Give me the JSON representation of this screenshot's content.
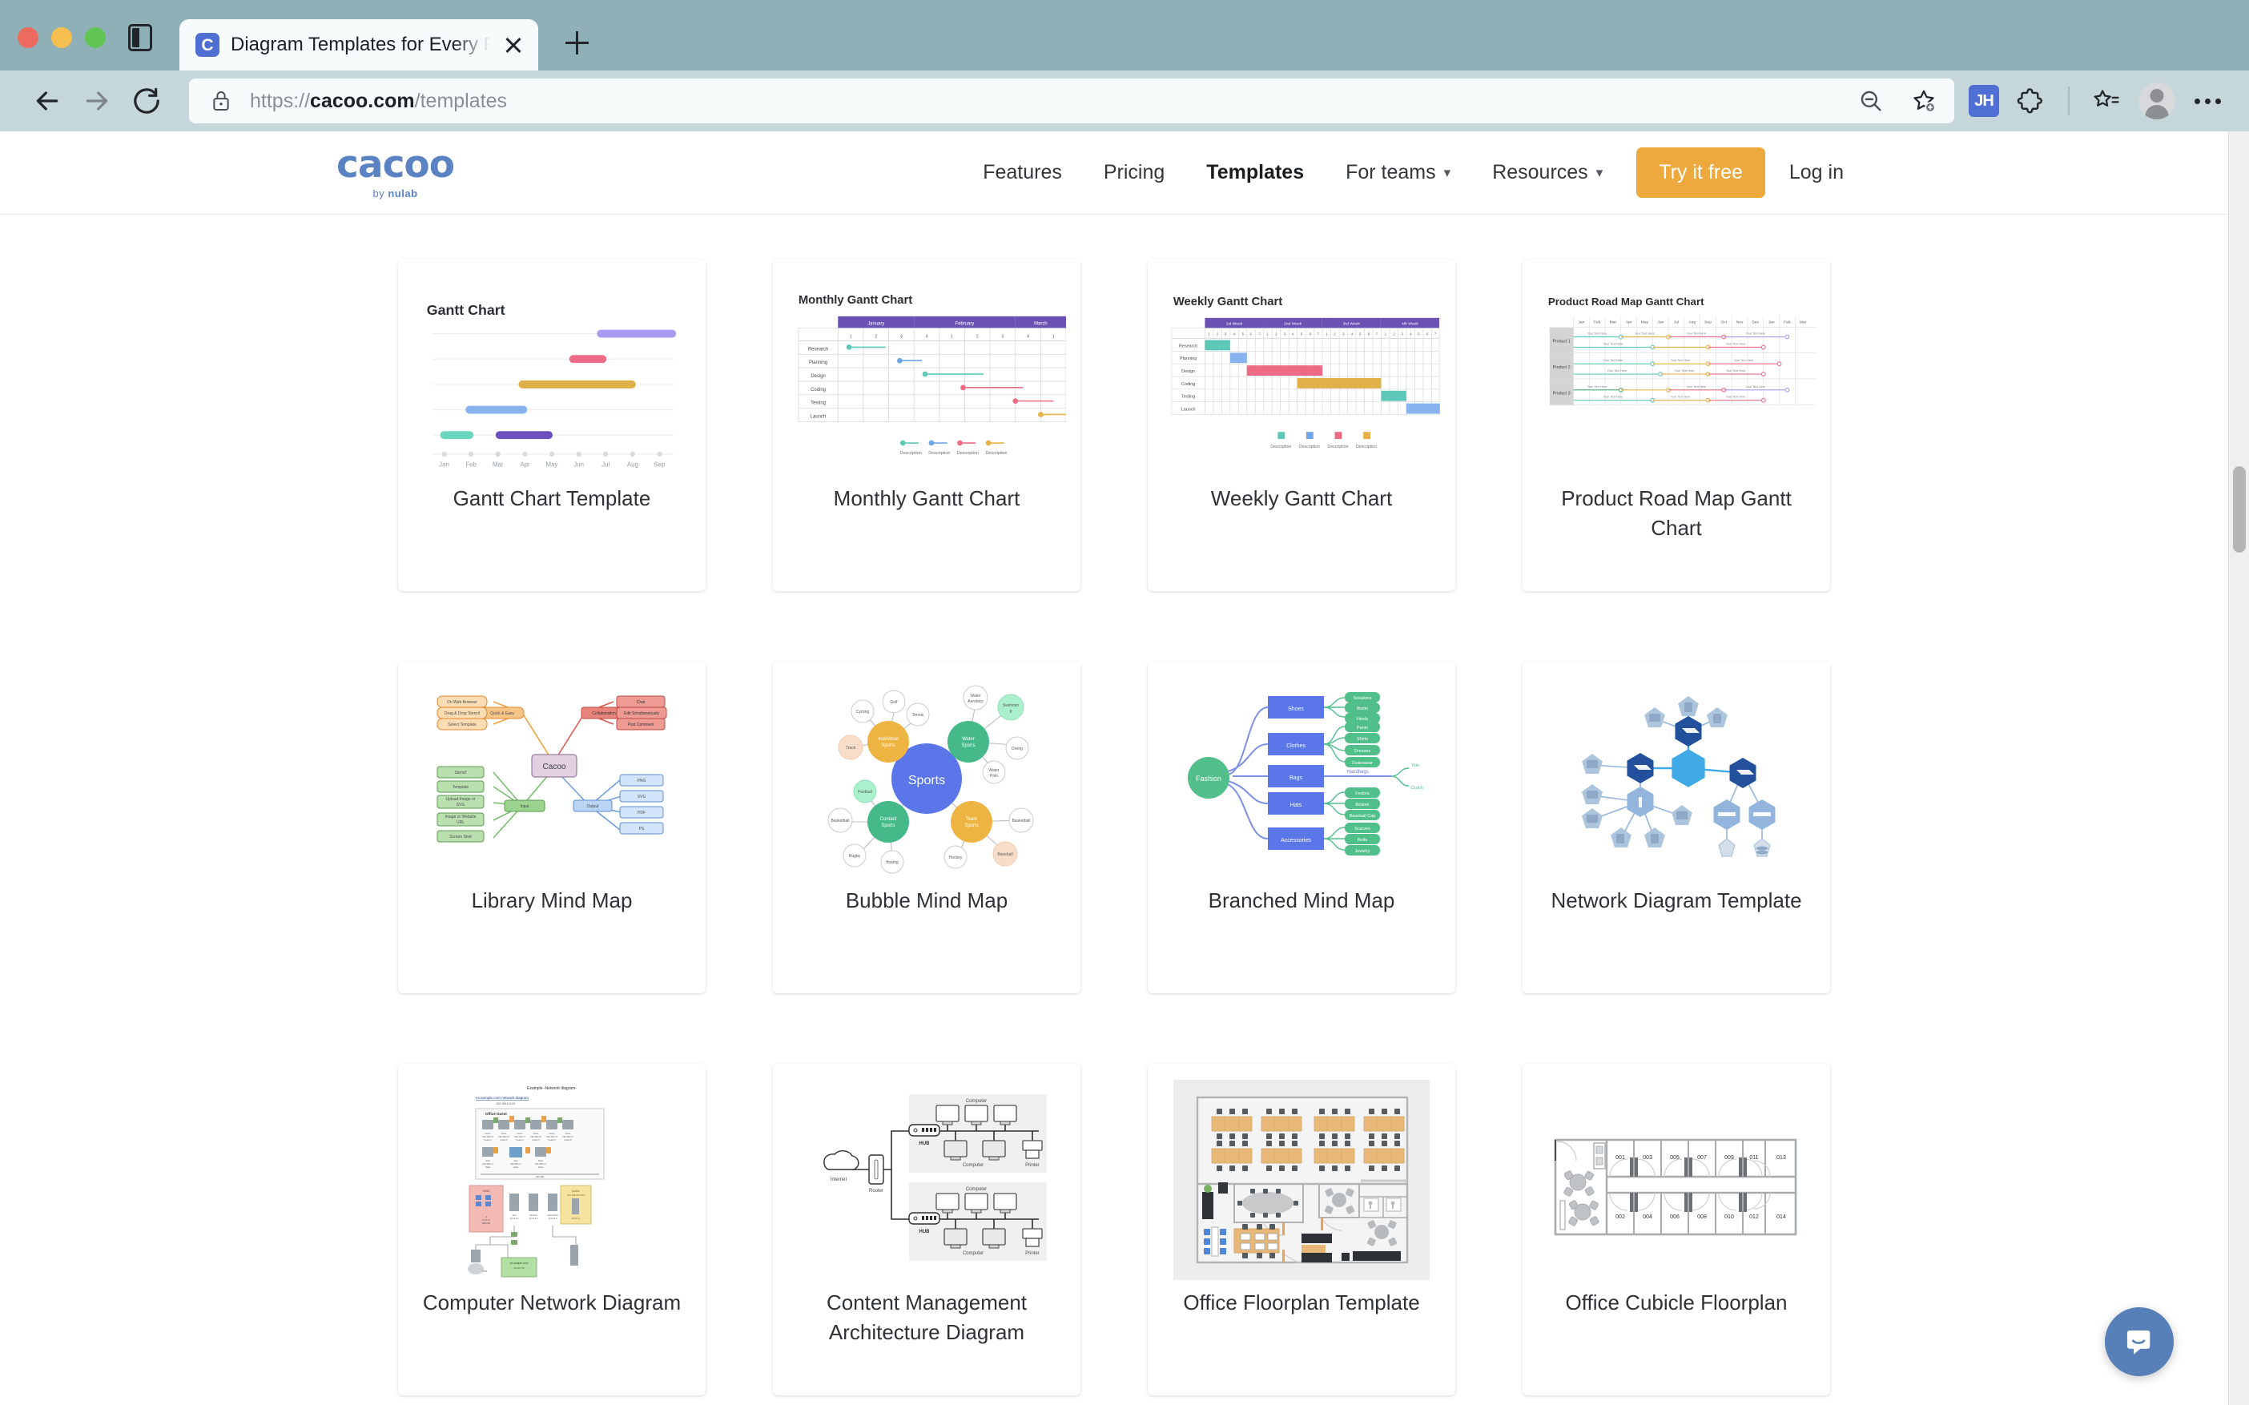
{
  "browser": {
    "tab": {
      "title": "Diagram Templates for Every P",
      "favicon_letter": "C",
      "favicon_name": "cacoo-favicon"
    },
    "new_tab_label": "+",
    "url_scheme": "https://",
    "url_domain": "cacoo.com",
    "url_path": "/templates",
    "extension_badge": "JH",
    "icons": {
      "back": "back-arrow-icon",
      "forward": "forward-arrow-icon",
      "reload": "reload-icon",
      "lock": "lock-icon",
      "zoom_out": "zoom-out-icon",
      "add_favorite": "add-favorite-icon",
      "extensions": "extensions-puzzle-icon",
      "collections": "collections-icon",
      "profile": "profile-avatar-icon",
      "settings": "more-settings-icon",
      "sidebar": "sidebar-toggle-icon",
      "close_tab": "close-icon"
    }
  },
  "site": {
    "logo": {
      "main": "cacoo",
      "by": "by ",
      "brand": "nulab"
    },
    "nav": [
      {
        "label": "Features",
        "active": false,
        "has_caret": false
      },
      {
        "label": "Pricing",
        "active": false,
        "has_caret": false
      },
      {
        "label": "Templates",
        "active": true,
        "has_caret": false
      },
      {
        "label": "For teams",
        "active": false,
        "has_caret": true
      },
      {
        "label": "Resources",
        "active": false,
        "has_caret": true
      }
    ],
    "cta_label": "Try it free",
    "login_label": "Log in",
    "accent_orange": "#eda93e",
    "brand_blue": "#5b82c2"
  },
  "templates": [
    {
      "label": "Gantt Chart Template",
      "thumb": "gantt-chart"
    },
    {
      "label": "Monthly Gantt Chart",
      "thumb": "monthly-gantt"
    },
    {
      "label": "Weekly Gantt Chart",
      "thumb": "weekly-gantt"
    },
    {
      "label": "Product Road Map Gantt Chart",
      "thumb": "roadmap-gantt"
    },
    {
      "label": "Library Mind Map",
      "thumb": "library-mindmap"
    },
    {
      "label": "Bubble Mind Map",
      "thumb": "bubble-mindmap"
    },
    {
      "label": "Branched Mind Map",
      "thumb": "branched-mindmap"
    },
    {
      "label": "Network Diagram Template",
      "thumb": "network-diagram"
    },
    {
      "label": "Computer Network Diagram",
      "thumb": "computer-network"
    },
    {
      "label": "Content Management Architecture Diagram",
      "thumb": "cms-architecture"
    },
    {
      "label": "Office Floorplan Template",
      "thumb": "office-floorplan"
    },
    {
      "label": "Office Cubicle Floorplan",
      "thumb": "office-cubicle"
    }
  ],
  "thumbnails": {
    "gantt_chart": {
      "title": "Gantt Chart",
      "months": [
        "Jan",
        "Feb",
        "Mar",
        "Apr",
        "May",
        "Jun",
        "Jul",
        "Aug",
        "Sep"
      ],
      "bars": [
        {
          "row": 0,
          "start": 6.5,
          "end": 9.0,
          "color": "#aa9af0"
        },
        {
          "row": 1,
          "start": 5.5,
          "end": 6.6,
          "color": "#ef6b85"
        },
        {
          "row": 2,
          "start": 3.3,
          "end": 7.8,
          "color": "#dfb04a"
        },
        {
          "row": 3,
          "start": 1.1,
          "end": 3.3,
          "color": "#87b4ef"
        },
        {
          "row": 4,
          "start": 0.0,
          "end": 1.2,
          "color": "#69d6bd"
        },
        {
          "row": 4,
          "start": 2.3,
          "end": 4.8,
          "color": "#6a4fbd"
        }
      ]
    },
    "monthly_gantt": {
      "title": "Monthly Gantt Chart",
      "month_headers": [
        "January",
        "February",
        "March"
      ],
      "week_numbers": [
        "1",
        "2",
        "3",
        "4",
        "1",
        "2",
        "3",
        "4",
        "1",
        "2",
        "3",
        "4"
      ],
      "rows": [
        "Research",
        "Planning",
        "Design",
        "Coding",
        "Testing",
        "Launch"
      ],
      "legend": [
        "Description",
        "Description",
        "Description",
        "Description"
      ],
      "legend_colors": [
        "#5ec8b8",
        "#6fa6e8",
        "#ef6b85",
        "#e8b04a"
      ],
      "tasks": [
        {
          "row": 0,
          "start": 0.3,
          "span": 2.2,
          "color": "#5ec8b8"
        },
        {
          "row": 1,
          "start": 2.3,
          "span": 1.3,
          "color": "#6fa6e8"
        },
        {
          "row": 2,
          "start": 3.3,
          "span": 3.2,
          "color": "#5ec8b8"
        },
        {
          "row": 3,
          "start": 5.3,
          "span": 3.2,
          "color": "#ef6b85"
        },
        {
          "row": 4,
          "start": 7.3,
          "span": 2.2,
          "color": "#ef6b85"
        },
        {
          "row": 5,
          "start": 9.3,
          "span": 2.5,
          "color": "#e8b04a"
        }
      ]
    },
    "weekly_gantt": {
      "title": "Weekly Gantt Chart",
      "week_headers": [
        "1st Week",
        "2nd Week",
        "3rd Week",
        "4th Week"
      ],
      "day_numbers": [
        "1",
        "2",
        "3",
        "4",
        "5",
        "6",
        "7"
      ],
      "rows": [
        "Research",
        "Planning",
        "Design",
        "Coding",
        "Testing",
        "Launch"
      ],
      "legend": [
        "Description",
        "Description",
        "Description",
        "Description"
      ],
      "legend_colors": [
        "#5ec8b8",
        "#6fa6e8",
        "#ef6b85",
        "#e8b04a"
      ],
      "tasks": [
        {
          "row": 0,
          "start": 0,
          "span": 3,
          "color": "#5ec8b8"
        },
        {
          "row": 1,
          "start": 3,
          "span": 2,
          "color": "#87b4ef"
        },
        {
          "row": 2,
          "start": 5,
          "span": 9,
          "color": "#ef6b85"
        },
        {
          "row": 3,
          "start": 11,
          "span": 10,
          "color": "#e0b04a"
        },
        {
          "row": 4,
          "start": 21,
          "span": 3,
          "color": "#5ec8b8"
        },
        {
          "row": 5,
          "start": 24,
          "span": 4,
          "color": "#87b4ef"
        }
      ]
    },
    "roadmap_gantt": {
      "title": "Product Road Map Gantt Chart",
      "months": [
        "Jan",
        "Feb",
        "Mar",
        "Apr",
        "May",
        "Jun",
        "Jul",
        "Aug",
        "Sep",
        "Oct",
        "Nov",
        "Dec",
        "Jan",
        "Feb",
        "Mar"
      ],
      "products": [
        "Product 1",
        "Product 2",
        "Product 3"
      ],
      "bar_text": "Your Text Here"
    },
    "library_mindmap": {
      "center": "Cacoo",
      "branches": [
        {
          "label": "Quick & Easy",
          "color": "#f0a23c",
          "children": [
            "On Web Browser",
            "Drag & Drop Stencil",
            "Select Template"
          ]
        },
        {
          "label": "Collaboration",
          "color": "#dc5a52",
          "children": [
            "Chat",
            "Edit Simultaneously",
            "Post Comment"
          ]
        },
        {
          "label": "Input",
          "color": "#78bf6d",
          "children": [
            "Stencil",
            "Template",
            "Upload Image or SVG",
            "Image or Website URL",
            "Screen Shot"
          ]
        },
        {
          "label": "Output",
          "color": "#6e9fe0",
          "children": [
            "PNG",
            "SVG",
            "PDF",
            "PS"
          ]
        }
      ]
    },
    "bubble_mindmap": {
      "center": "Sports",
      "clusters": [
        {
          "label": "Individual Sports",
          "color": "#eeb442",
          "children": [
            "Cycling",
            "Golf",
            "Tennis",
            "Track"
          ]
        },
        {
          "label": "Water Sports",
          "color": "#45b98a",
          "children": [
            "Water Aerobics",
            "Swimming",
            "Diving",
            "Water Polo"
          ]
        },
        {
          "label": "Contact Sports",
          "color": "#45b98a",
          "children": [
            "Football",
            "Basketball",
            "Rugby",
            "Boxing"
          ]
        },
        {
          "label": "Team Sports",
          "color": "#eeb442",
          "children": [
            "Baseball",
            "Hockey",
            "Basketball"
          ]
        }
      ]
    },
    "branched_mindmap": {
      "center": "Fashion",
      "branch_color": "#5b76e8",
      "leaf_color": "#50bf8a",
      "branches": [
        {
          "label": "Shoes",
          "children": [
            "Sneakers",
            "Boots",
            "Heels"
          ]
        },
        {
          "label": "Clothes",
          "children": [
            "Pants",
            "Shirts",
            "Dresses",
            "Outerwear"
          ]
        },
        {
          "label": "Bags",
          "children": [
            "Handbags",
            "Tote",
            "Clutch"
          ]
        },
        {
          "label": "Hats",
          "children": [
            "Fedora",
            "Beanie",
            "Baseball Cap"
          ]
        },
        {
          "label": "Accessories",
          "children": [
            "Scarves",
            "Belts",
            "Jewelry"
          ]
        }
      ]
    },
    "network_diagram": {
      "colors": {
        "cloud": "#3fa9e5",
        "router": "#23509c",
        "switch": "#93b4dd",
        "node": "#adc4dd"
      }
    },
    "computer_network": {
      "title": "Example -Network diagram-",
      "subtitle": "ex.sample.com network diagram",
      "ip": "192.168.0.0/24",
      "zone_label": "Office Guest",
      "labels": [
        "DMZ",
        "public",
        "ex.sample.com",
        "VPN"
      ]
    },
    "cms_architecture": {
      "nodes": [
        "Internet",
        "Router",
        "HUB",
        "Computer",
        "Printer"
      ]
    },
    "office_floorplan": {
      "desk_color": "#e8b878",
      "wall_color": "#b3b3b3",
      "bg": "#ededed"
    },
    "office_cubicle": {
      "room_numbers_top": [
        "001",
        "003",
        "005",
        "007",
        "009",
        "011",
        "013"
      ],
      "room_numbers_bottom": [
        "002",
        "004",
        "006",
        "008",
        "010",
        "012",
        "014"
      ]
    }
  },
  "chat": {
    "name": "intercom-chat-launcher",
    "color": "#5780b8"
  }
}
